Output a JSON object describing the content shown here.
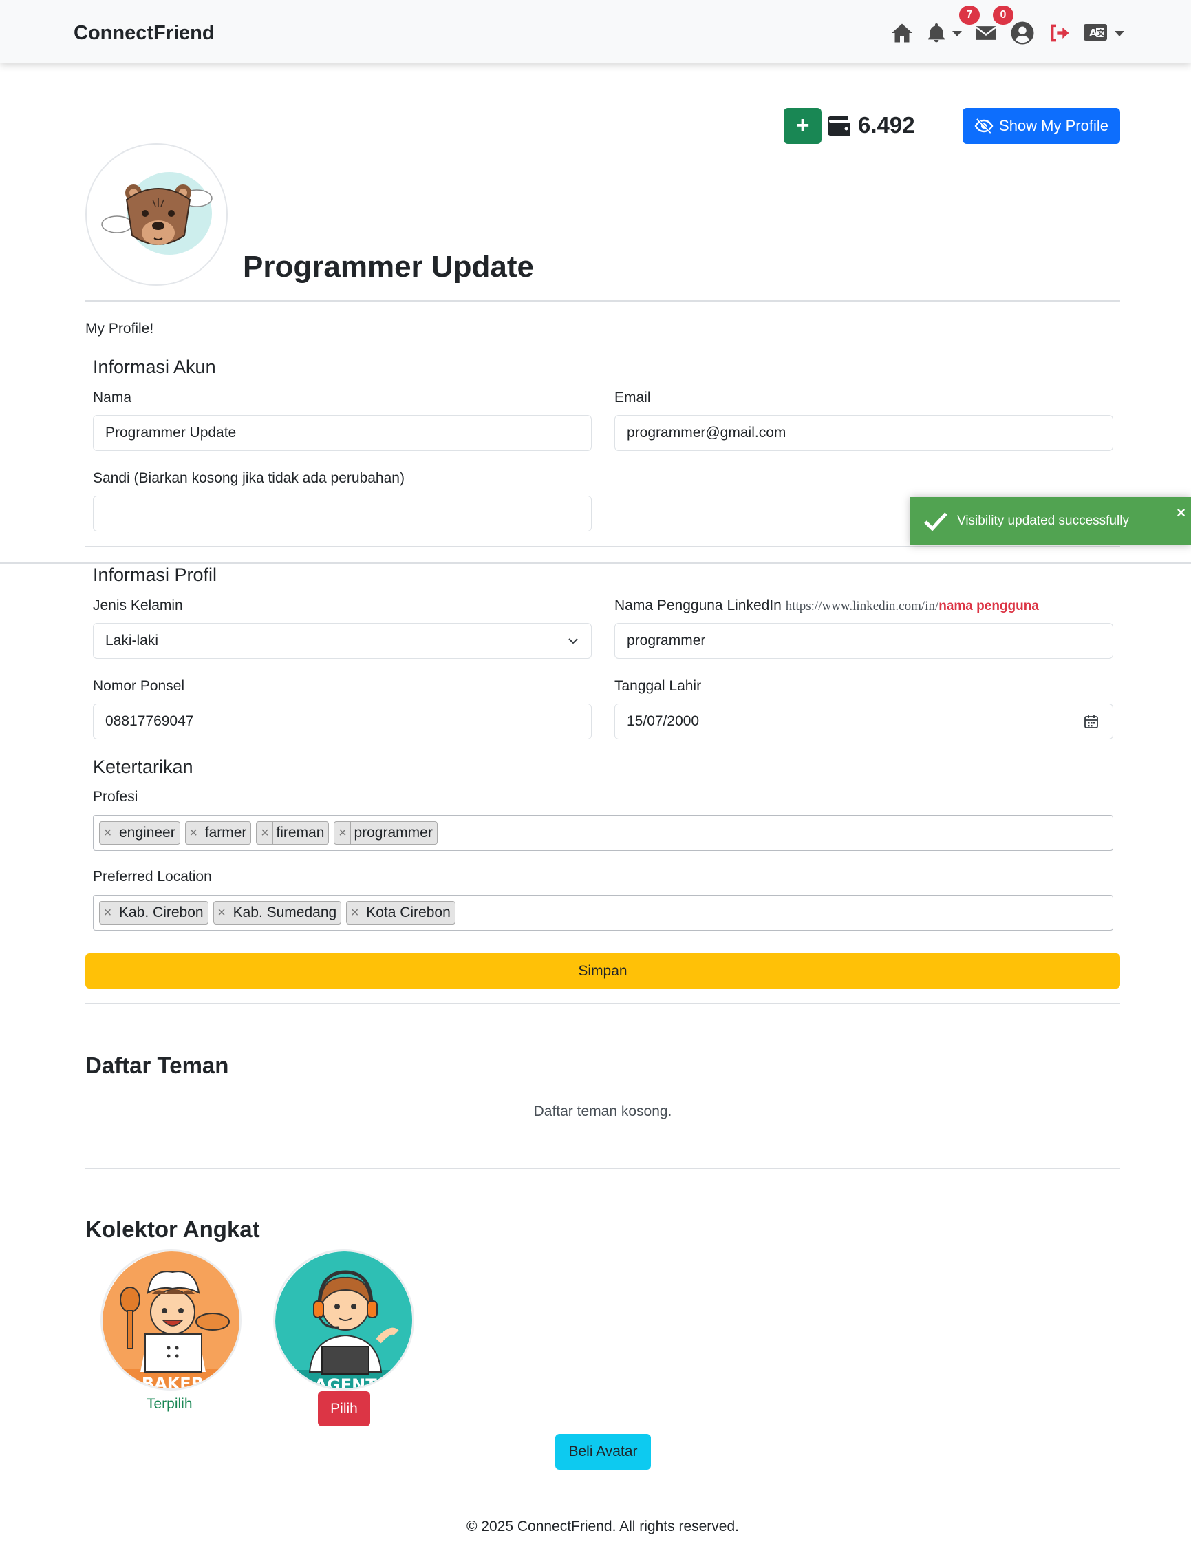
{
  "navbar": {
    "brand": "ConnectFriend",
    "notifications_count": "7",
    "messages_count": "0",
    "icons": [
      "home-icon",
      "bell-icon",
      "envelope-icon",
      "user-circle-icon",
      "logout-icon",
      "language-icon"
    ]
  },
  "wallet": {
    "plus_label": "+",
    "amount": "6.492",
    "show_profile_label": "Show My Profile"
  },
  "profile": {
    "title": "Programmer Update",
    "intro": "My Profile!"
  },
  "account": {
    "section_title": "Informasi Akun",
    "name_label": "Nama",
    "name_value": "Programmer Update",
    "email_label": "Email",
    "email_value": "programmer@gmail.com",
    "password_label": "Sandi (Biarkan kosong jika tidak ada perubahan)",
    "password_value": ""
  },
  "profile_info": {
    "section_title": "Informasi Profil",
    "gender_label": "Jenis Kelamin",
    "gender_value": "Laki-laki",
    "linkedin_label": "Nama Pengguna LinkedIn",
    "linkedin_url_prefix": "https://www.linkedin.com/in/",
    "linkedin_url_placeholder": "nama pengguna",
    "linkedin_value": "programmer",
    "phone_label": "Nomor Ponsel",
    "phone_value": "08817769047",
    "birth_label": "Tanggal Lahir",
    "birth_value": "15/07/2000"
  },
  "interests": {
    "section_title": "Ketertarikan",
    "profession_label": "Profesi",
    "professions": [
      "engineer",
      "farmer",
      "fireman",
      "programmer"
    ],
    "location_label": "Preferred Location",
    "locations": [
      "Kab. Cirebon",
      "Kab. Sumedang",
      "Kota Cirebon"
    ],
    "tag_remove_symbol": "×"
  },
  "save_label": "Simpan",
  "toast": {
    "message": "Visibility updated successfully",
    "close_symbol": "×",
    "color": "#51a351"
  },
  "friends": {
    "title": "Daftar Teman",
    "empty_text": "Daftar teman kosong."
  },
  "collectors": {
    "title": "Kolektor Angkat",
    "items": [
      {
        "caption": "BAKER",
        "status": "Terpilih"
      },
      {
        "caption": "AGENT",
        "action": "Pilih"
      }
    ],
    "buy_label": "Beli Avatar"
  },
  "footer": {
    "text": "© 2025 ConnectFriend. All rights reserved."
  },
  "colors": {
    "primary": "#0d6efd",
    "success": "#198754",
    "warning": "#ffc107",
    "danger": "#dc3545",
    "info": "#0dcaf0"
  }
}
